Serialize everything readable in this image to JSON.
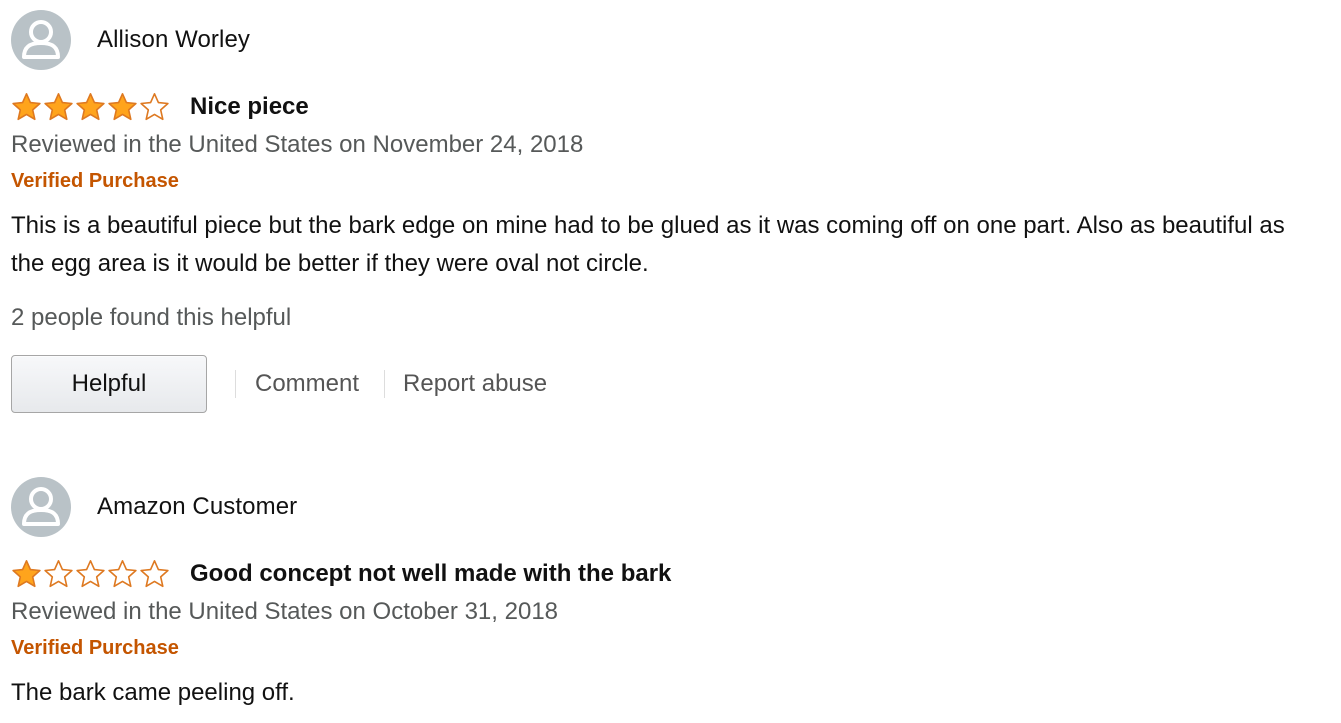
{
  "colors": {
    "star_fill": "#FFA41C",
    "star_outline": "#DE7921",
    "verified": "#C45500",
    "muted_text": "#565959",
    "avatar_bg": "#B9C2C7"
  },
  "reviews": [
    {
      "reviewer": "Allison Worley",
      "avatar_icon": "default-profile-icon",
      "rating": 4,
      "max_rating": 5,
      "title": "Nice piece",
      "date": "Reviewed in the United States on November 24, 2018",
      "verified": "Verified Purchase",
      "body": "This is a beautiful piece but the bark edge on mine had to be glued as it was coming off on one part. Also as beautiful as the egg area is it would be better if they were oval not circle.",
      "helpful_count": "2 people found this helpful",
      "helpful_button": "Helpful",
      "comment_link": "Comment",
      "report_link": "Report abuse"
    },
    {
      "reviewer": "Amazon Customer",
      "avatar_icon": "default-profile-icon",
      "rating": 1,
      "max_rating": 5,
      "title": "Good concept not well made with the bark",
      "date": "Reviewed in the United States on October 31, 2018",
      "verified": "Verified Purchase",
      "body": "The bark came peeling off."
    }
  ]
}
